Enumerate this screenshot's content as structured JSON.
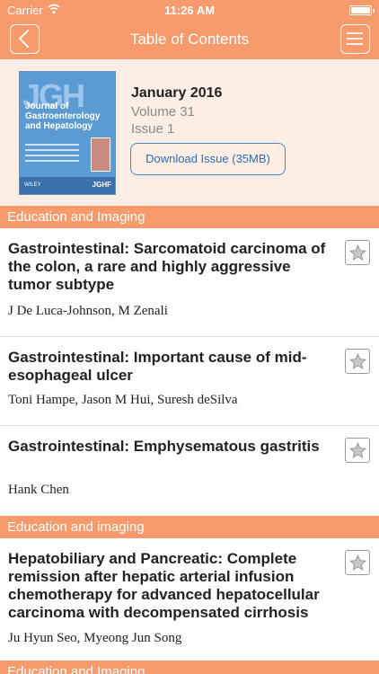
{
  "status_bar": {
    "carrier": "Carrier",
    "time": "11:26 AM"
  },
  "nav": {
    "title": "Table of Contents",
    "back_icon": "chevron-left-icon",
    "menu_icon": "hamburger-menu-icon"
  },
  "issue": {
    "cover": {
      "logo": "JGH",
      "journal_title": "Journal of Gastroenterology and Hepatology",
      "publisher": "WILEY",
      "society": "JGHF"
    },
    "month": "January 2016",
    "volume": "Volume 31",
    "issue": "Issue 1",
    "download_label": "Download Issue (35MB)"
  },
  "sections": [
    {
      "title": "Education and Imaging",
      "articles": [
        {
          "title": "Gastrointestinal: Sarcomatoid carcinoma of the colon, a rare and highly aggressive tumor subtype",
          "authors": "J De Luca-Johnson, M Zenali"
        },
        {
          "title": "Gastrointestinal: Important cause of mid-esophageal ulcer",
          "authors": "Toni Hampe, Jason M Hui, Suresh deSilva"
        },
        {
          "title": "Gastrointestinal: Emphysematous gastritis",
          "authors": "Hank Chen"
        }
      ]
    },
    {
      "title": "Education and imaging",
      "articles": [
        {
          "title": "Hepatobiliary and Pancreatic: Complete remission after hepatic arterial infusion chemotherapy for advanced hepatocellular carcinoma with decompensated cirrhosis",
          "authors": "Ju Hyun Seo, Myeong Jun Song"
        }
      ]
    },
    {
      "title": "Education and Imaging"
    }
  ],
  "colors": {
    "accent": "#f79a6c",
    "issue_bg": "#fdeee5",
    "link": "#2f6db5"
  }
}
